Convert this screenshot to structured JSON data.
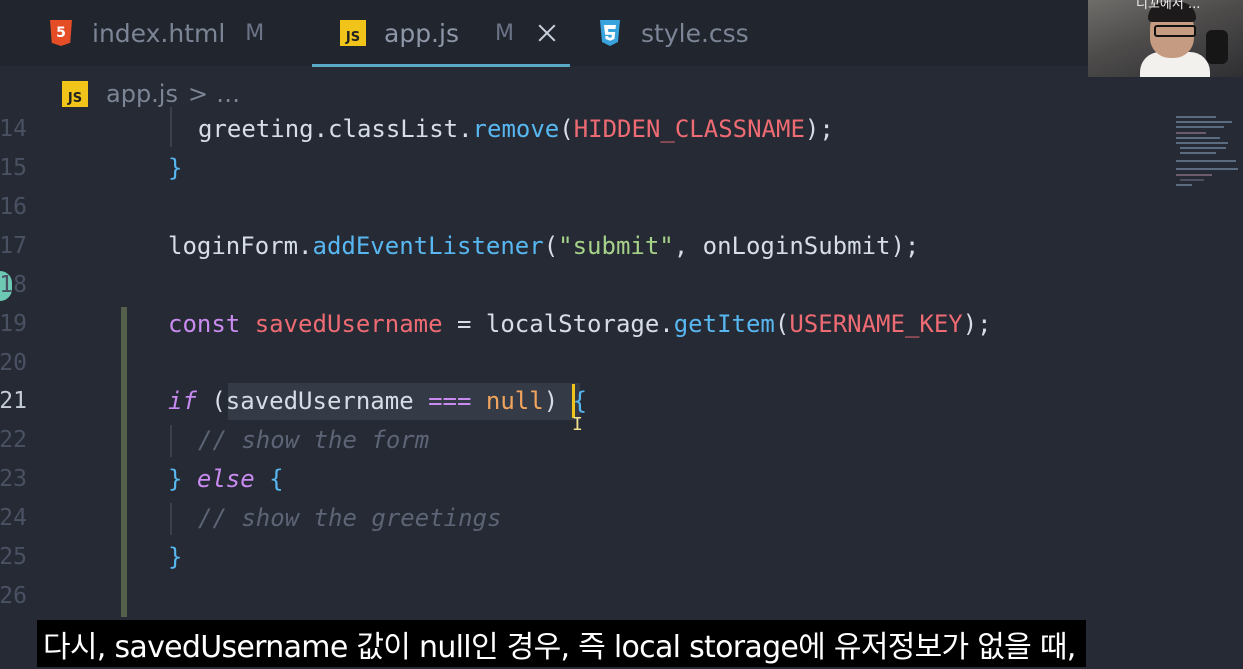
{
  "tabs": [
    {
      "name": "index.html",
      "badge": "M",
      "icon": "html5-icon",
      "active": false
    },
    {
      "name": "app.js",
      "badge": "M",
      "icon": "js-icon",
      "active": true
    },
    {
      "name": "style.css",
      "badge": "",
      "icon": "css3-icon",
      "active": false
    }
  ],
  "icon_text": {
    "html": "5",
    "js": "JS"
  },
  "breadcrumb": {
    "file": "app.js",
    "separator": ">",
    "more": "…"
  },
  "editor": {
    "active_line": 21,
    "lines": [
      {
        "n": "14",
        "code": "greeting.classList.remove(HIDDEN_CLASSNAME);"
      },
      {
        "n": "15",
        "code": "}"
      },
      {
        "n": "16",
        "code": ""
      },
      {
        "n": "17",
        "code": "loginForm.addEventListener(\"submit\", onLoginSubmit);"
      },
      {
        "n": "18",
        "code": ""
      },
      {
        "n": "19",
        "code": "const savedUsername = localStorage.getItem(USERNAME_KEY);"
      },
      {
        "n": "20",
        "code": ""
      },
      {
        "n": "21",
        "code": "if (savedUsername === null) {"
      },
      {
        "n": "22",
        "code": "// show the form"
      },
      {
        "n": "23",
        "code": "} else {"
      },
      {
        "n": "24",
        "code": "// show the greetings"
      },
      {
        "n": "25",
        "code": "}"
      },
      {
        "n": "26",
        "code": ""
      }
    ]
  },
  "tokens": {
    "l14": [
      "greeting",
      ".",
      "classList",
      ".",
      "remove",
      "(",
      "HIDDEN_CLASSNAME",
      ");"
    ],
    "l15": [
      "}"
    ],
    "l17": [
      "loginForm",
      ".",
      "addEventListener",
      "(",
      "\"submit\"",
      ", onLoginSubmit);"
    ],
    "l19": [
      "const",
      " ",
      "savedUsername",
      " = localStorage.",
      "getItem",
      "(",
      "USERNAME_KEY",
      ");"
    ],
    "l21": [
      "if",
      " (savedUsername ",
      "===",
      " ",
      "null",
      ") ",
      "{"
    ],
    "l22": [
      "// show the form"
    ],
    "l23": [
      "}",
      " ",
      "else",
      " ",
      "{"
    ],
    "l24": [
      "// show the greetings"
    ],
    "l25": [
      "}"
    ]
  },
  "webcam": {
    "label": "니꼬에서 ..."
  },
  "subtitle": "다시, savedUsername 값이 null인 경우, 즉 local storage에 유저정보가 없을 때,",
  "colors": {
    "background": "#252a34",
    "tab_underline": "#5aa9c7",
    "function": "#58b7f0",
    "constant": "#ef6b73",
    "string": "#a6d189",
    "keyword": "#c98bf0",
    "comment": "#5c6475"
  }
}
